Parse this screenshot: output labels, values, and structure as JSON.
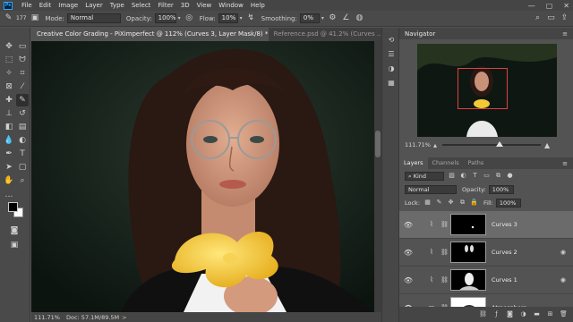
{
  "menubar": {
    "logo": "Ps",
    "items": [
      "File",
      "Edit",
      "Image",
      "Layer",
      "Type",
      "Select",
      "Filter",
      "3D",
      "View",
      "Window",
      "Help"
    ],
    "window_controls": [
      "—",
      "▢",
      "✕"
    ]
  },
  "options": {
    "brush_size": "177",
    "mode_label": "Mode:",
    "mode_value": "Normal",
    "opacity_label": "Opacity:",
    "opacity_value": "100%",
    "flow_label": "Flow:",
    "flow_value": "10%",
    "smoothing_label": "Smoothing:",
    "smoothing_value": "0%"
  },
  "tabs": [
    {
      "label": "Creative Color Grading - PiXimperfect @ 112% (Curves 3, Layer Mask/8) *",
      "close": "×",
      "active": true
    },
    {
      "label": "Reference.psd @ 41.2% (Curves ...",
      "close": "",
      "active": false
    }
  ],
  "status": {
    "zoom": "111.71%",
    "doc": "Doc: 57.1M/89.5M",
    "chevron": ">"
  },
  "navigator": {
    "title": "Navigator",
    "zoom": "111.71%",
    "zoom_fraction": 0.58
  },
  "layers_panel": {
    "tabs": [
      "Layers",
      "Channels",
      "Paths"
    ],
    "kind_label": "Kind",
    "blend_mode": "Normal",
    "opacity_label": "Opacity:",
    "opacity_value": "100%",
    "lock_label": "Lock:",
    "fill_label": "Fill:",
    "fill_value": "100%",
    "layers": [
      {
        "name": "Curves 3",
        "selected": true
      },
      {
        "name": "Curves 2",
        "selected": false
      },
      {
        "name": "Curves 1",
        "selected": false
      },
      {
        "name": "Atmosphere",
        "selected": false
      }
    ]
  },
  "colors": {
    "accent": "#31a8ff",
    "navigator_frame": "#e04040",
    "flower": "#f3c935"
  }
}
